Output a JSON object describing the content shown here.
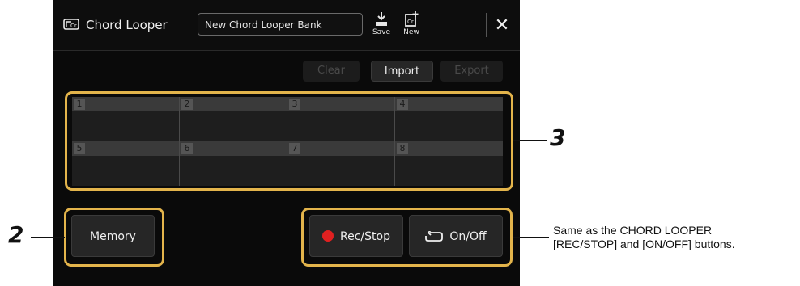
{
  "titlebar": {
    "app_title": "Chord Looper",
    "bank_name": "New Chord Looper Bank",
    "save_label": "Save",
    "new_label": "New",
    "close_glyph": "✕"
  },
  "actions": {
    "clear_label": "Clear",
    "import_label": "Import",
    "export_label": "Export"
  },
  "memory_slots": [
    "1",
    "2",
    "3",
    "4",
    "5",
    "6",
    "7",
    "8"
  ],
  "bottom": {
    "memory_label": "Memory",
    "rec_stop_label": "Rec/Stop",
    "on_off_label": "On/Off"
  },
  "callouts": {
    "num_2": "2",
    "num_3": "3",
    "note_line1": "Same as the CHORD LOOPER",
    "note_line2": "[REC/STOP] and [ON/OFF] buttons."
  },
  "colors": {
    "highlight": "#e3b44b",
    "record": "#e02020",
    "background": "#0a0a0a"
  },
  "icons": {
    "app": "chord-looper-icon",
    "save": "save-icon",
    "new": "new-file-icon",
    "close": "close-icon",
    "rec": "record-dot-icon",
    "loop": "loop-icon"
  }
}
